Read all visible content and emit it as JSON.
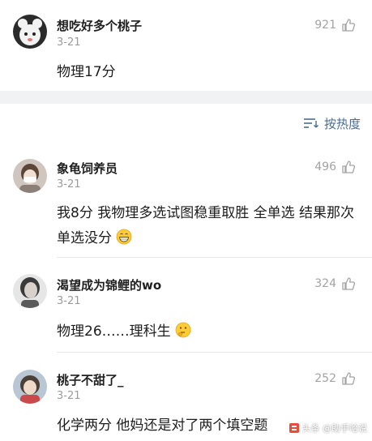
{
  "comments": [
    {
      "name": "想吃好多个桃子",
      "time": "3-21",
      "likes": "921",
      "text": "物理17分"
    },
    {
      "name": "象龟饲养员",
      "time": "3-21",
      "likes": "496",
      "text": "我8分 我物理多选试图稳重取胜 全单选 结果那次单选没分"
    },
    {
      "name": "渴望成为锦鲤的wo",
      "time": "3-21",
      "likes": "324",
      "text": "物理26……理科生"
    },
    {
      "name": "桃子不甜了_",
      "time": "3-21",
      "likes": "252",
      "text": "化学两分 他妈还是对了两个填空题"
    }
  ],
  "sort": {
    "label": "按热度",
    "icon": "sort-lines-icon"
  },
  "watermark": {
    "text": "头条 @助手哈说"
  },
  "colors": {
    "accent": "#4a6c93",
    "separator": "#f1f2f4",
    "meta": "#9b9b9b"
  }
}
